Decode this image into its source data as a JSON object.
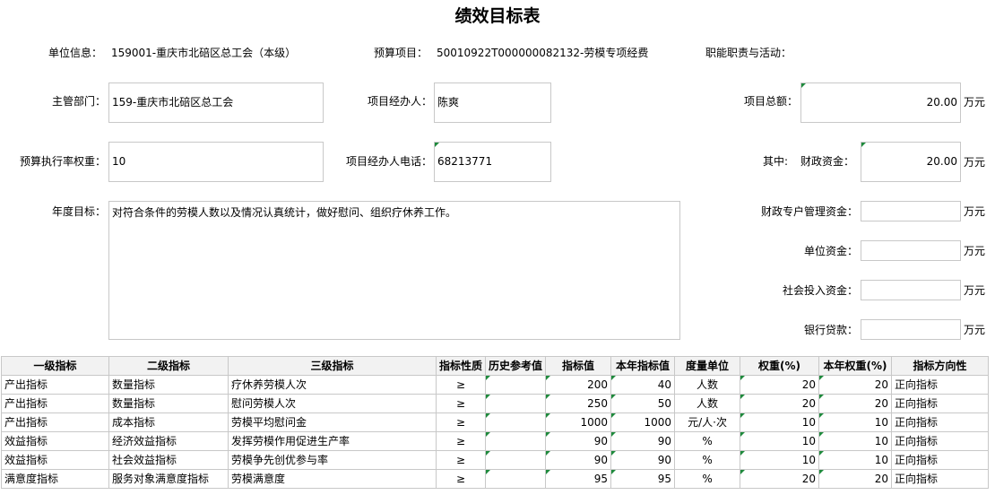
{
  "title": "绩效目标表",
  "header": {
    "unit_label": "单位信息：",
    "unit_value": "159001-重庆市北碚区总工会（本级）",
    "budget_project_label": "预算项目：",
    "budget_project_value": "50010922T000000082132-劳模专项经费",
    "duties_label": "职能职责与活动："
  },
  "form": {
    "dept_label": "主管部门：",
    "dept_value": "159-重庆市北碚区总工会",
    "manager_label": "项目经办人：",
    "manager_value": "陈爽",
    "total_label": "项目总额：",
    "total_value": "20.00",
    "weight_label": "预算执行率权重：",
    "weight_value": "10",
    "phone_label": "项目经办人电话：",
    "phone_value": "68213771",
    "of_which_label": "其中:",
    "fiscal_label": "财政资金：",
    "fiscal_value": "20.00",
    "annual_goal_label": "年度目标：",
    "annual_goal_value": "对符合条件的劳模人数以及情况认真统计，做好慰问、组织疗休养工作。",
    "special_label": "财政专户管理资金：",
    "special_value": "",
    "unit_fund_label": "单位资金：",
    "unit_fund_value": "",
    "social_label": "社会投入资金：",
    "social_value": "",
    "loan_label": "银行贷款：",
    "loan_value": "",
    "currency_unit": "万元"
  },
  "table": {
    "headers": [
      "一级指标",
      "二级指标",
      "三级指标",
      "指标性质",
      "历史参考值",
      "指标值",
      "本年指标值",
      "度量单位",
      "权重(%)",
      "本年权重(%)",
      "指标方向性"
    ],
    "rows": [
      [
        "产出指标",
        "数量指标",
        "疗休养劳模人次",
        "≥",
        "",
        "200",
        "40",
        "人数",
        "20",
        "20",
        "正向指标"
      ],
      [
        "产出指标",
        "数量指标",
        "慰问劳模人次",
        "≥",
        "",
        "250",
        "50",
        "人数",
        "20",
        "20",
        "正向指标"
      ],
      [
        "产出指标",
        "成本指标",
        "劳模平均慰问金",
        "≥",
        "",
        "1000",
        "1000",
        "元/人·次",
        "10",
        "10",
        "正向指标"
      ],
      [
        "效益指标",
        "经济效益指标",
        "发挥劳模作用促进生产率",
        "≥",
        "",
        "90",
        "90",
        "%",
        "10",
        "10",
        "正向指标"
      ],
      [
        "效益指标",
        "社会效益指标",
        "劳模争先创优参与率",
        "≥",
        "",
        "90",
        "90",
        "%",
        "10",
        "10",
        "正向指标"
      ],
      [
        "满意度指标",
        "服务对象满意度指标",
        "劳模满意度",
        "≥",
        "",
        "95",
        "95",
        "%",
        "20",
        "20",
        "正向指标"
      ]
    ]
  },
  "colors": {
    "marker": "#1e8a3c",
    "border": "#c8c8c8",
    "header_bg": "#f2f2f2"
  }
}
